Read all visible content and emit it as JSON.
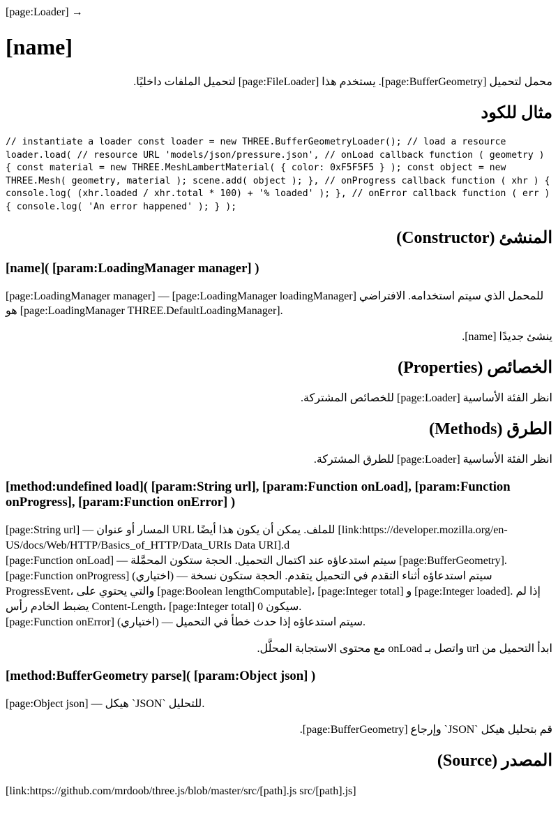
{
  "breadcrumb": "[page:Loader] →",
  "title": "[name]",
  "intro": "محمل لتحميل [page:BufferGeometry]. يستخدم هذا [page:FileLoader] لتحميل الملفات داخليًا.",
  "code_heading": "مثال للكود",
  "code_example": "// instantiate a loader const loader = new THREE.BufferGeometryLoader(); // load a resource loader.load( // resource URL 'models/json/pressure.json', // onLoad callback function ( geometry ) { const material = new THREE.MeshLambertMaterial( { color: 0xF5F5F5 } ); const object = new THREE.Mesh( geometry, material ); scene.add( object ); }, // onProgress callback function ( xhr ) { console.log( (xhr.loaded / xhr.total * 100) + '% loaded' ); }, // onError callback function ( err ) { console.log( 'An error happened' ); } );",
  "constructor": {
    "heading": "المنشئ (Constructor)",
    "signature": "[name]( [param:LoadingManager manager] )",
    "param_desc": "[page:LoadingManager manager] — [page:LoadingManager loadingManager] للمحمل الذي سيتم استخدامه. الافتراضي هو [page:LoadingManager THREE.DefaultLoadingManager].",
    "desc": "ينشئ جديدًا [name]."
  },
  "properties": {
    "heading": "الخصائص (Properties)",
    "desc": "انظر الفئة الأساسية [page:Loader] للخصائص المشتركة."
  },
  "methods": {
    "heading": "الطرق (Methods)",
    "desc": "انظر الفئة الأساسية [page:Loader] للطرق المشتركة."
  },
  "load": {
    "signature": "[method:undefined load]( [param:String url], [param:Function onLoad], [param:Function onProgress], [param:Function onError] )",
    "params": [
      "[page:String url] — المسار أو عنوان URL للملف. يمكن أن يكون هذا أيضًا [link:https://developer.mozilla.org/en-US/docs/Web/HTTP/Basics_of_HTTP/Data_URIs Data URI].d",
      "[page:Function onLoad] — سيتم استدعاؤه عند اكتمال التحميل. الحجة ستكون المحمَّلة [page:BufferGeometry].",
      "[page:Function onProgress] (اختياري) — سيتم استدعاؤه أثناء التقدم في التحميل يتقدم. الحجة ستكون نسخة ProgressEvent، والتي يحتوي على [page:Boolean lengthComputable]، [page:Integer total] و [page:Integer loaded]. إذا لم يضبط الخادم رأس Content-Length، [page:Integer total] سيكون 0.",
      "[page:Function onError] (اختياري) — سيتم استدعاؤه إذا حدث خطأ في التحميل."
    ],
    "desc": "ابدأ التحميل من url واتصل بـ onLoad مع محتوى الاستجابة المحلَّل."
  },
  "parse": {
    "signature": "[method:BufferGeometry parse]( [param:Object json] )",
    "param_desc": "[page:Object json] — هيكل `JSON` للتحليل.",
    "desc": "قم بتحليل هيكل `JSON` وإرجاع [page:BufferGeometry]."
  },
  "source": {
    "heading": "المصدر (Source)",
    "link": "[link:https://github.com/mrdoob/three.js/blob/master/src/[path].js src/[path].js]"
  }
}
